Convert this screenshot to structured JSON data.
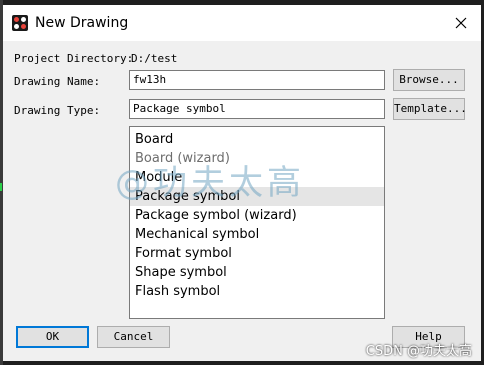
{
  "window": {
    "title": "New Drawing"
  },
  "form": {
    "project_directory_label": "Project Directory:",
    "project_directory_value": "D:/test",
    "drawing_name_label": "Drawing Name:",
    "drawing_name_value": "fw13h",
    "drawing_type_label": "Drawing Type:",
    "drawing_type_value": "Package symbol",
    "browse_label": "Browse...",
    "template_label": "Template..."
  },
  "type_list": {
    "items": [
      "Board",
      "Board (wizard)",
      "Module",
      "Package symbol",
      "Package symbol (wizard)",
      "Mechanical symbol",
      "Format symbol",
      "Shape symbol",
      "Flash symbol"
    ],
    "selected": "Package symbol"
  },
  "buttons": {
    "ok": "OK",
    "cancel": "Cancel",
    "help": "Help"
  },
  "watermarks": {
    "center": "@功夫太高",
    "corner": "CSDN @功夫太高"
  }
}
